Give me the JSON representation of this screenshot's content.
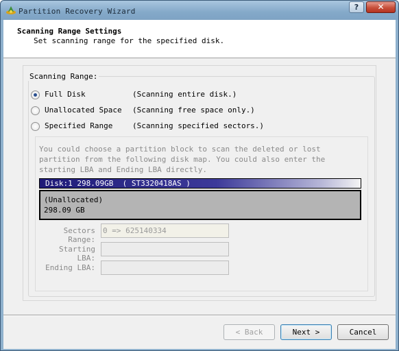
{
  "window": {
    "title": "Partition Recovery Wizard",
    "help_label": "?",
    "close_label": "✕"
  },
  "header": {
    "title": "Scanning Range Settings",
    "subtitle": "Set scanning range for the specified disk."
  },
  "scanning_range": {
    "group_label": "Scanning Range:",
    "options": [
      {
        "label": "Full Disk",
        "description": "(Scanning entire disk.)",
        "checked": true
      },
      {
        "label": "Unallocated Space",
        "description": "(Scanning free space only.)",
        "checked": false
      },
      {
        "label": "Specified Range",
        "description": "(Scanning specified sectors.)",
        "checked": false
      }
    ]
  },
  "disk_map": {
    "info": "You could choose a partition block to scan the deleted or lost partition from the following disk map. You could also enter the starting LBA and Ending LBA directly.",
    "disk_label": "Disk:1 298.09GB  ( ST3320418AS )",
    "partition_name": "(Unallocated)",
    "partition_size": "298.09 GB"
  },
  "fields": {
    "sectors_label": "Sectors Range:",
    "sectors_value": "0 => 625140334",
    "starting_label": "Starting LBA:",
    "starting_value": "",
    "ending_label": "Ending LBA:",
    "ending_value": ""
  },
  "buttons": {
    "back": "< Back",
    "next": "Next >",
    "cancel": "Cancel"
  },
  "colors": {
    "disk_bar": "#1e1a78",
    "partition": "#b4b4b4",
    "title_bar": "#84a9c9",
    "close_button": "#c7503b"
  }
}
